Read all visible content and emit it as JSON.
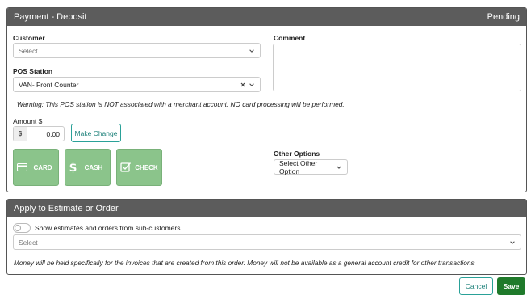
{
  "deposit": {
    "title": "Payment - Deposit",
    "status": "Pending",
    "customer_label": "Customer",
    "customer_placeholder": "Select",
    "pos_label": "POS Station",
    "pos_value": "VAN- Front Counter",
    "warning": "Warning: This POS station is NOT associated with a merchant account. NO card processing will be performed.",
    "comment_label": "Comment",
    "amount_label": "Amount $",
    "amount_prefix": "$",
    "amount_value": "0.00",
    "make_change": "Make Change",
    "payment_buttons": [
      {
        "label": "CARD",
        "icon": "card-icon"
      },
      {
        "label": "CASH",
        "icon": "dollar-icon"
      },
      {
        "label": "CHECK",
        "icon": "check-edit-icon"
      }
    ],
    "other_options_label": "Other Options",
    "other_options_select": "Select Other Option"
  },
  "apply": {
    "title": "Apply to Estimate or Order",
    "toggle_label": "Show estimates and orders from sub-customers",
    "select_placeholder": "Select",
    "note": "Money will be held specifically for the invoices that are created from this order. Money will not be available as a general account credit for other transactions."
  },
  "footer": {
    "cancel": "Cancel",
    "save": "Save"
  },
  "colors": {
    "header_bg": "#5c5c5c",
    "pay_button": "#8bc48b",
    "save_button": "#1f7a2b",
    "cancel_border": "#2aa198"
  }
}
